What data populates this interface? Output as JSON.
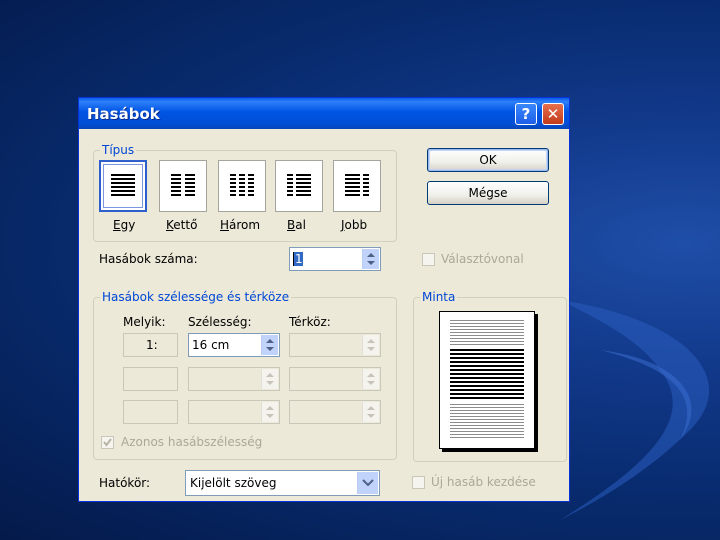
{
  "dialog": {
    "title": "Hasábok",
    "help_glyph": "?",
    "close_glyph": "✕"
  },
  "types": {
    "group_label": "Típus",
    "items": [
      {
        "label": "Egy",
        "mnemonic": "E",
        "rest": "gy",
        "icon": "one-column-icon",
        "selected": true
      },
      {
        "label": "Kettő",
        "mnemonic": "K",
        "rest": "ettő",
        "icon": "two-columns-icon",
        "selected": false
      },
      {
        "label": "Három",
        "mnemonic": "H",
        "rest": "árom",
        "icon": "three-columns-icon",
        "selected": false
      },
      {
        "label": "Bal",
        "mnemonic": "B",
        "rest": "al",
        "icon": "left-column-icon",
        "selected": false
      },
      {
        "label": "Jobb",
        "mnemonic": "J",
        "rest": "obb",
        "icon": "right-column-icon",
        "selected": false
      }
    ]
  },
  "buttons": {
    "ok": "OK",
    "cancel": "Mégse"
  },
  "count": {
    "label": "Hasábok száma:",
    "value": "1"
  },
  "separator": {
    "label": "Választóvonal",
    "checked": false
  },
  "width_spacing": {
    "group_label": "Hasábok szélessége és térköze",
    "col_header": "Melyik:",
    "width_header": "Szélesség:",
    "spacing_header": "Térköz:",
    "rows": [
      {
        "index": "1:",
        "width": "16 cm",
        "spacing": ""
      },
      {
        "index": "",
        "width": "",
        "spacing": ""
      },
      {
        "index": "",
        "width": "",
        "spacing": ""
      }
    ]
  },
  "equal_width": {
    "label": "Azonos hasábszélesség",
    "checked": true
  },
  "preview": {
    "group_label": "Minta"
  },
  "scope": {
    "label": "Hatókör:",
    "value": "Kijelölt szöveg"
  },
  "new_column": {
    "label": "Új hasáb kezdése",
    "checked": false
  },
  "colors": {
    "title_bar": "#0054e3",
    "dialog_bg": "#ece9d8",
    "group_label": "#0046d5",
    "disabled_text": "#aca899"
  }
}
